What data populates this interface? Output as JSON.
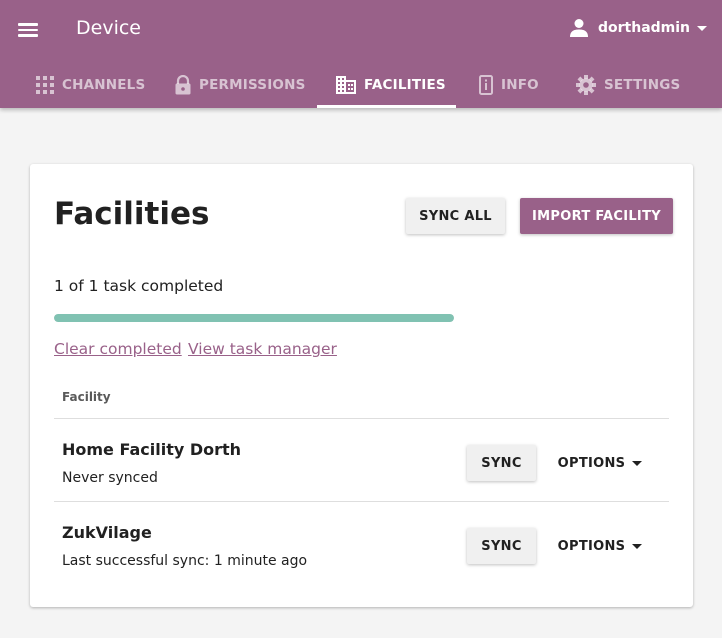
{
  "appbar": {
    "title": "Device",
    "user": {
      "name": "dorthadmin",
      "icon": "person-icon"
    },
    "color": "#996189"
  },
  "tabs": [
    {
      "label": "CHANNELS",
      "icon": "grid-icon",
      "active": false
    },
    {
      "label": "PERMISSIONS",
      "icon": "lock-icon",
      "active": false
    },
    {
      "label": "FACILITIES",
      "icon": "building-icon",
      "active": true
    },
    {
      "label": "INFO",
      "icon": "info-icon",
      "active": false
    },
    {
      "label": "SETTINGS",
      "icon": "gear-icon",
      "active": false
    }
  ],
  "main": {
    "title": "Facilities",
    "sync_all_label": "SYNC ALL",
    "import_label": "IMPORT FACILITY",
    "task_status": "1 of 1 task completed",
    "progress": 1.0,
    "progress_color": "#80c2b2",
    "clear_link": "Clear completed",
    "task_manager_link": "View task manager",
    "column_header": "Facility",
    "facilities": [
      {
        "name": "Home Facility Dorth",
        "status": "Never synced",
        "sync_label": "SYNC",
        "options_label": "OPTIONS"
      },
      {
        "name": "ZukVilage",
        "status": "Last successful sync: 1 minute ago",
        "sync_label": "SYNC",
        "options_label": "OPTIONS"
      }
    ]
  }
}
